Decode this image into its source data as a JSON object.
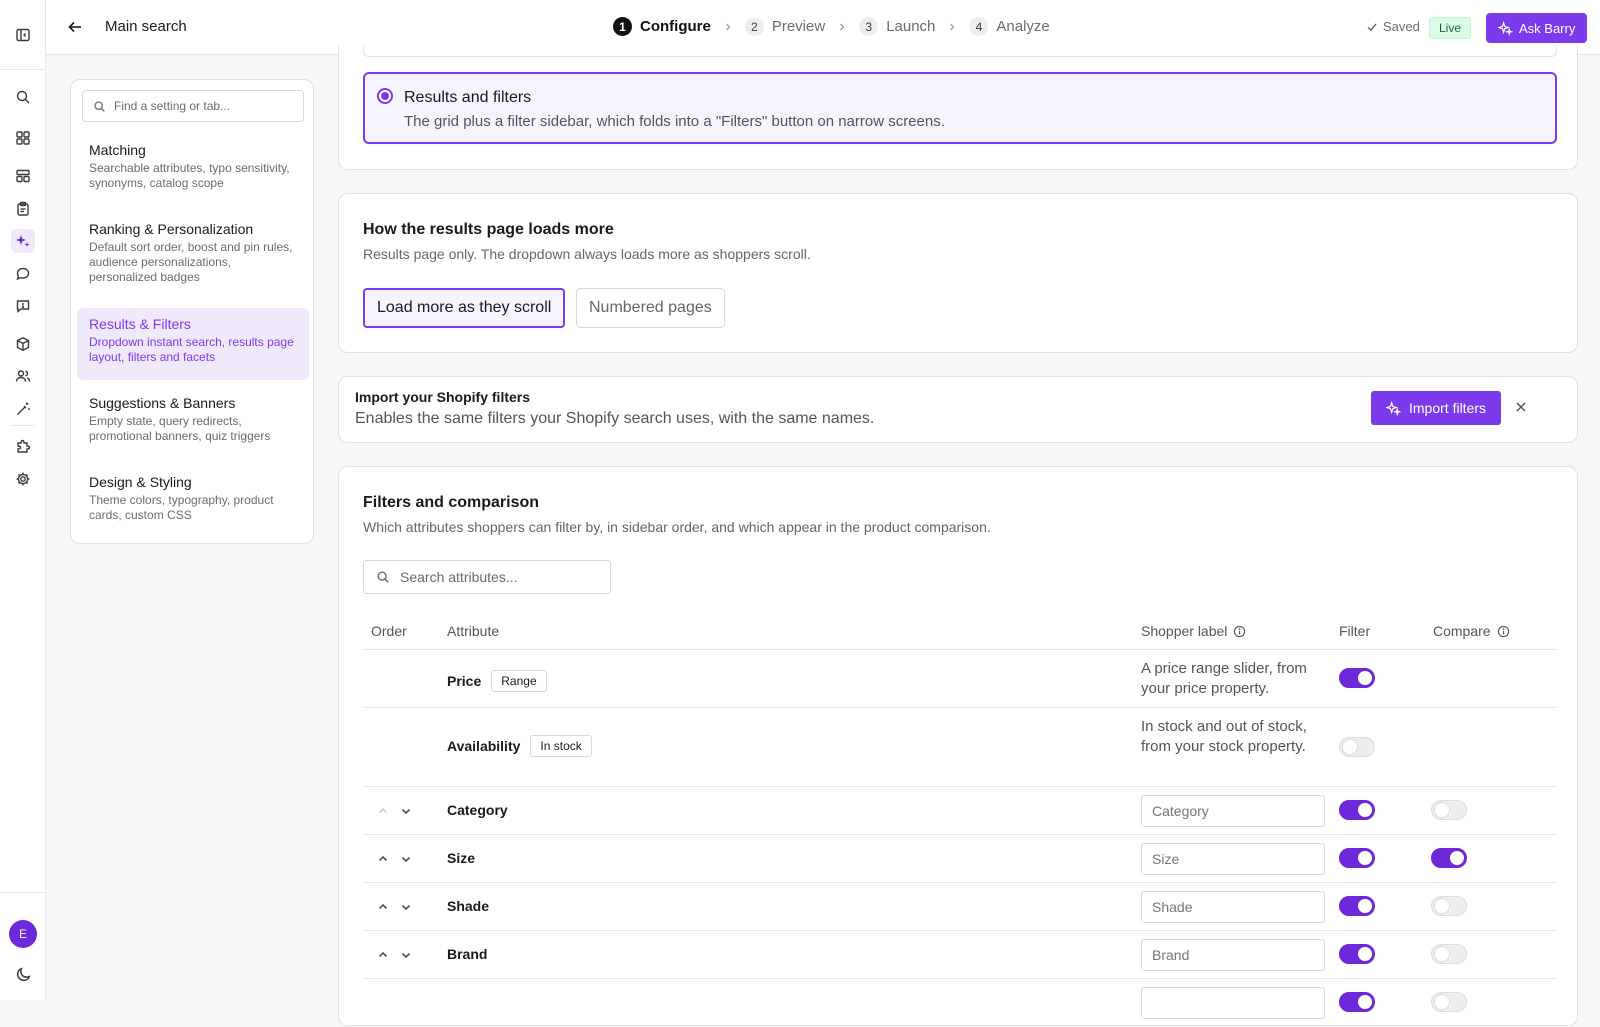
{
  "topbar": {
    "title": "Main search",
    "steps": [
      {
        "num": "1",
        "label": "Configure"
      },
      {
        "num": "2",
        "label": "Preview"
      },
      {
        "num": "3",
        "label": "Launch"
      },
      {
        "num": "4",
        "label": "Analyze"
      }
    ],
    "saved": "Saved",
    "live": "Live",
    "ask": "Ask Barry"
  },
  "user_initial": "E",
  "nav": {
    "search_placeholder": "Find a setting or tab...",
    "items": [
      {
        "title": "Matching",
        "desc": "Searchable attributes, typo sensitivity, synonyms, catalog scope"
      },
      {
        "title": "Ranking & Personalization",
        "desc": "Default sort order, boost and pin rules, audience personalizations, personalized badges"
      },
      {
        "title": "Results & Filters",
        "desc": "Dropdown instant search, results page layout, filters and facets"
      },
      {
        "title": "Suggestions & Banners",
        "desc": "Empty state, query redirects, promotional banners, quiz triggers"
      },
      {
        "title": "Design & Styling",
        "desc": "Theme colors, typography, product cards, custom CSS"
      }
    ]
  },
  "layout_card": {
    "option_title": "Results and filters",
    "option_desc": "The grid plus a filter sidebar, which folds into a \"Filters\" button on narrow screens."
  },
  "load_more": {
    "title": "How the results page loads more",
    "subtitle": "Results page only. The dropdown always loads more as shoppers scroll.",
    "options": [
      "Load more as they scroll",
      "Numbered pages"
    ],
    "selected": "Load more as they scroll"
  },
  "import": {
    "title": "Import your Shopify filters",
    "desc": "Enables the same filters your Shopify search uses, with the same names.",
    "button": "Import filters"
  },
  "filters": {
    "title": "Filters and comparison",
    "subtitle": "Which attributes shoppers can filter by, in sidebar order, and which appear in the product comparison.",
    "search_placeholder": "Search attributes...",
    "columns": {
      "order": "Order",
      "attribute": "Attribute",
      "shopper_label": "Shopper label",
      "filter": "Filter",
      "compare": "Compare"
    },
    "rows": [
      {
        "name": "Price",
        "tag": "Range",
        "label": "A price range slider, from your price property.",
        "filter": true
      },
      {
        "name": "Availability",
        "tag": "In stock",
        "label": "In stock and out of stock, from your stock property.",
        "filter": false
      },
      {
        "name": "Category",
        "label_value": "Category",
        "filter": true,
        "compare": false
      },
      {
        "name": "Size",
        "label_value": "Size",
        "filter": true,
        "compare": true
      },
      {
        "name": "Shade",
        "label_value": "Shade",
        "filter": true,
        "compare": false
      },
      {
        "name": "Brand",
        "label_value": "Brand",
        "filter": true,
        "compare": false
      }
    ]
  },
  "colors": {
    "accent": "#7c3aed",
    "live_bg": "#dcfce7"
  }
}
